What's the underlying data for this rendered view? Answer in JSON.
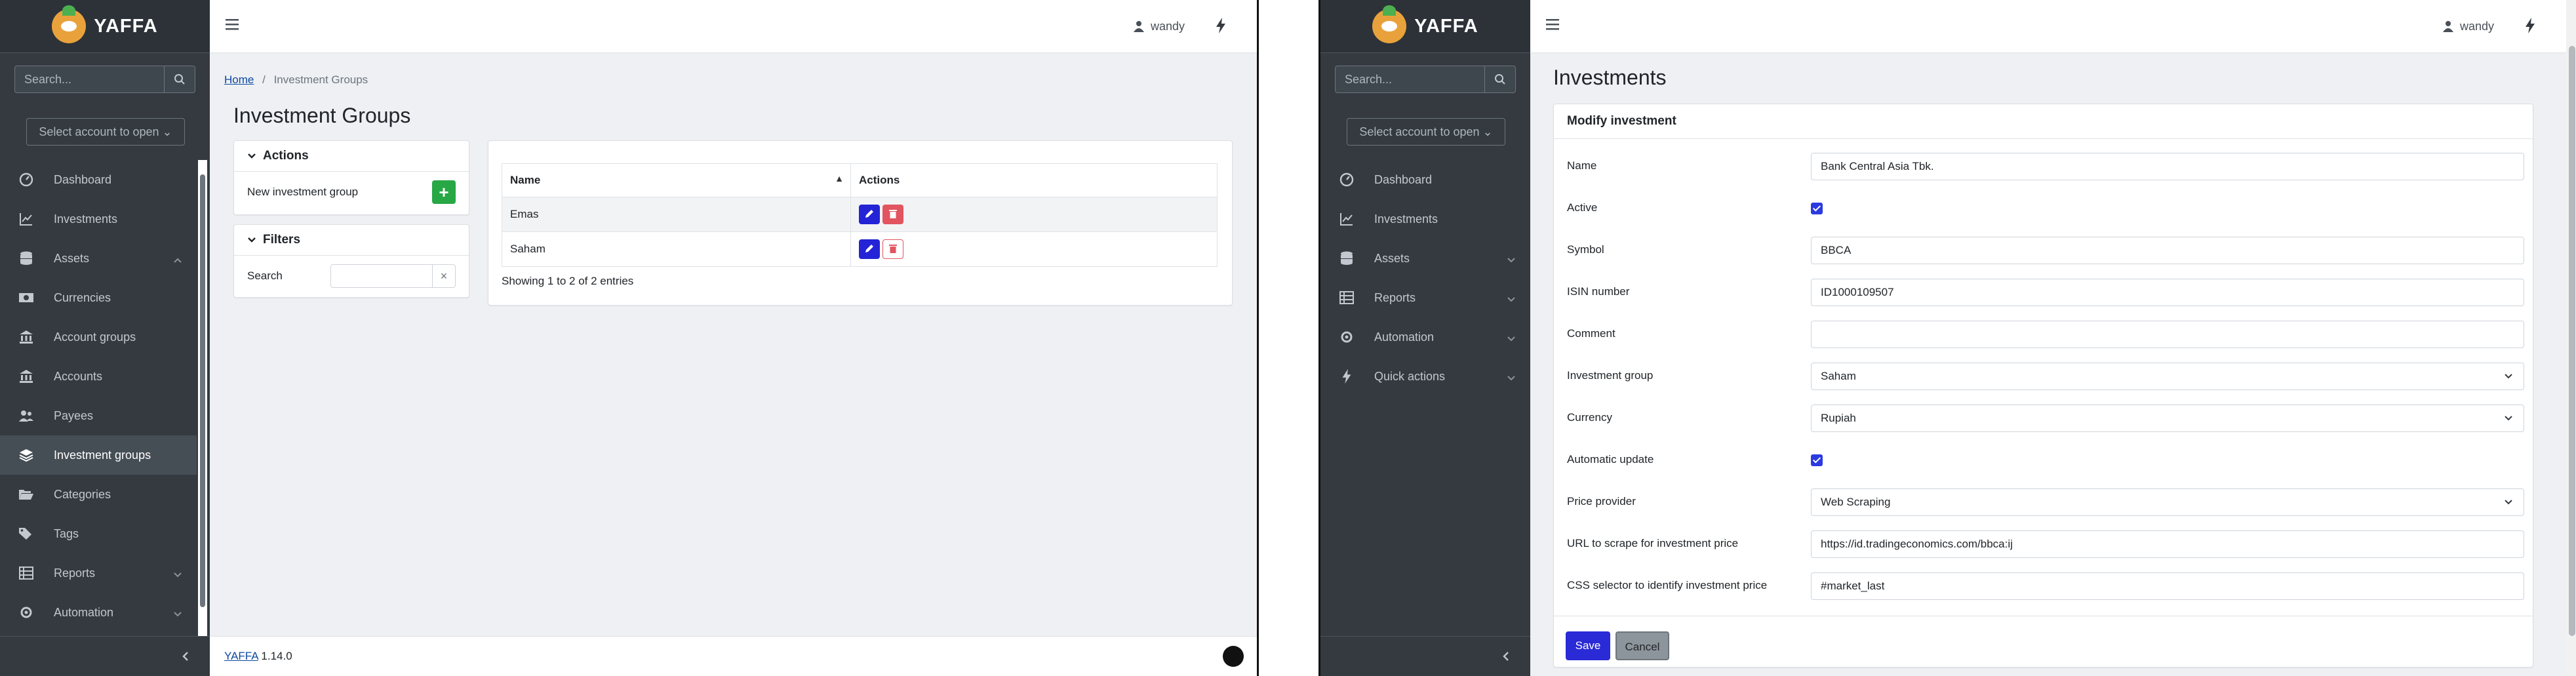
{
  "app": {
    "name": "YAFFA",
    "version": "1.14.0"
  },
  "left": {
    "search_placeholder": "Search...",
    "account_select": "Select account to open",
    "nav": [
      {
        "label": "Dashboard",
        "icon": "dashboard-icon"
      },
      {
        "label": "Investments",
        "icon": "chart-line-icon"
      },
      {
        "label": "Assets",
        "icon": "database-icon",
        "expandable": true
      },
      {
        "label": "Currencies",
        "icon": "money-bill-icon"
      },
      {
        "label": "Account groups",
        "icon": "bank-icon"
      },
      {
        "label": "Accounts",
        "icon": "university-icon"
      },
      {
        "label": "Payees",
        "icon": "users-icon"
      },
      {
        "label": "Investment groups",
        "icon": "layer-group-icon",
        "active": true
      },
      {
        "label": "Categories",
        "icon": "folder-open-icon"
      },
      {
        "label": "Tags",
        "icon": "tags-icon"
      },
      {
        "label": "Reports",
        "icon": "table-icon",
        "expandable": true
      },
      {
        "label": "Automation",
        "icon": "robot-icon",
        "expandable": true
      }
    ],
    "user": "wandy",
    "breadcrumb": {
      "home": "Home",
      "separator": "/",
      "current": "Investment Groups"
    },
    "title": "Investment Groups",
    "actions": {
      "header": "Actions",
      "new_label": "New investment group",
      "new_button": "+"
    },
    "filters": {
      "header": "Filters",
      "search_label": "Search",
      "clear": "×"
    },
    "table": {
      "columns": [
        "Name",
        "Actions"
      ],
      "rows": [
        {
          "name": "Emas"
        },
        {
          "name": "Saham"
        }
      ],
      "info": "Showing 1 to 2 of 2 entries"
    },
    "footer": {
      "app_link": "YAFFA",
      "version": "1.14.0"
    }
  },
  "right": {
    "search_placeholder": "Search...",
    "account_select": "Select account to open",
    "nav": [
      {
        "label": "Dashboard",
        "icon": "dashboard-icon"
      },
      {
        "label": "Investments",
        "icon": "chart-line-icon"
      },
      {
        "label": "Assets",
        "icon": "database-icon",
        "expandable": true
      },
      {
        "label": "Reports",
        "icon": "table-icon",
        "expandable": true
      },
      {
        "label": "Automation",
        "icon": "robot-icon",
        "expandable": true
      },
      {
        "label": "Quick actions",
        "icon": "bolt-icon",
        "expandable": true
      }
    ],
    "user": "wandy",
    "title": "Investments",
    "form": {
      "header": "Modify investment",
      "fields": {
        "name": {
          "label": "Name",
          "value": "Bank Central Asia Tbk."
        },
        "active": {
          "label": "Active",
          "checked": true
        },
        "symbol": {
          "label": "Symbol",
          "value": "BBCA"
        },
        "isin": {
          "label": "ISIN number",
          "value": "ID1000109507"
        },
        "comment": {
          "label": "Comment",
          "value": ""
        },
        "group": {
          "label": "Investment group",
          "value": "Saham"
        },
        "currency": {
          "label": "Currency",
          "value": "Rupiah"
        },
        "auto_update": {
          "label": "Automatic update",
          "checked": true
        },
        "provider": {
          "label": "Price provider",
          "value": "Web Scraping"
        },
        "url": {
          "label": "URL to scrape for investment price",
          "value": "https://id.tradingeconomics.com/bbca:ij"
        },
        "css": {
          "label": "CSS selector to identify investment price",
          "value": "#market_last"
        }
      },
      "save": "Save",
      "cancel": "Cancel"
    }
  },
  "colors": {
    "sidebar": "#343a40",
    "primary": "#2a2ad6",
    "success": "#28a745",
    "danger": "#e2545f"
  }
}
